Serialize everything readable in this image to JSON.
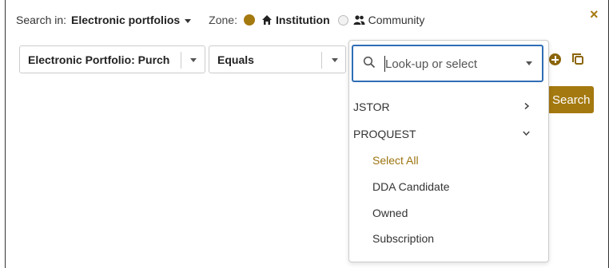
{
  "top": {
    "search_in_label": "Search in:",
    "scope_value": "Electronic portfolios",
    "zone_label": "Zone:",
    "zone_institution": "Institution",
    "zone_community": "Community"
  },
  "close_icon": "×",
  "filters": {
    "field_value": "Electronic Portfolio: Purchase Model",
    "operator_value": "Equals"
  },
  "lookup": {
    "placeholder": "Look-up or select"
  },
  "search_button": "Search",
  "dropdown": {
    "groups": [
      {
        "label": "JSTOR",
        "expanded": false
      },
      {
        "label": "PROQUEST",
        "expanded": true
      }
    ],
    "select_all": "Select All",
    "options": [
      "DDA Candidate",
      "Owned",
      "Subscription"
    ]
  },
  "colors": {
    "accent": "#a4790f",
    "focus_border": "#2f6db5"
  },
  "icons": [
    "caret-down-icon",
    "radio-selected-icon",
    "home-icon",
    "radio-unselected-icon",
    "community-icon",
    "close-icon",
    "search-icon",
    "add-icon",
    "copy-icon",
    "chevron-right-icon",
    "chevron-down-icon"
  ]
}
